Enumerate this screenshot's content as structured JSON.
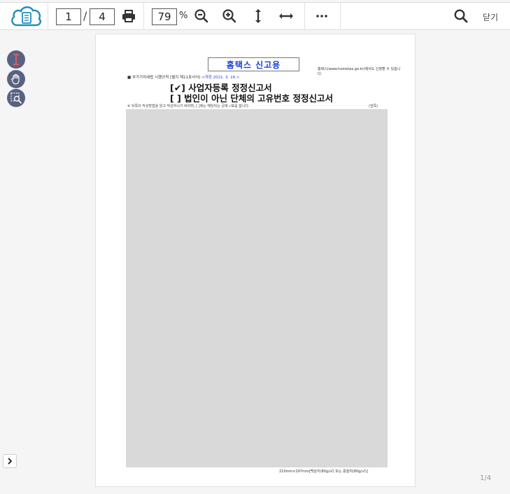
{
  "toolbar": {
    "logo_icon": "cloud-document-icon",
    "current_page": "1",
    "separator": "/",
    "total_pages": "4",
    "zoom_value": "79",
    "zoom_unit": "%",
    "close_label": "닫기"
  },
  "left_tools": [
    "text-select-icon",
    "hand-pan-icon",
    "area-zoom-icon"
  ],
  "document": {
    "stamp": "홈택스 신고용",
    "law_ref_prefix": "■ 부가가치세법 시행규칙 [별지 제11호서식]",
    "law_ref_revised": "<개정 2021. 3. 16.>",
    "hometax_note": "홈택스(www.hometax.go.kr)에서도 신청할 수 있습니다.",
    "title_line1": "[✔] 사업자등록 정정신고서",
    "title_line2": "[  ] 법인이 아닌 단체의 고유번호 정정신고서",
    "instruction": "※ 뒤쪽의 작성방법을 읽고 작성하시기 바라며, [  ]에는 해당되는 곳에 √표를 합니다.",
    "side_label": "(앞쪽)",
    "paper_spec": "210mm×297mm[백상지(80g/㎡) 또는 중질지(80g/㎡)]"
  },
  "status": {
    "page_indicator": "1/4"
  },
  "colors": {
    "accent": "#1a3fd6",
    "tool_button": "#5a6281",
    "logo": "#1c8fb8"
  }
}
